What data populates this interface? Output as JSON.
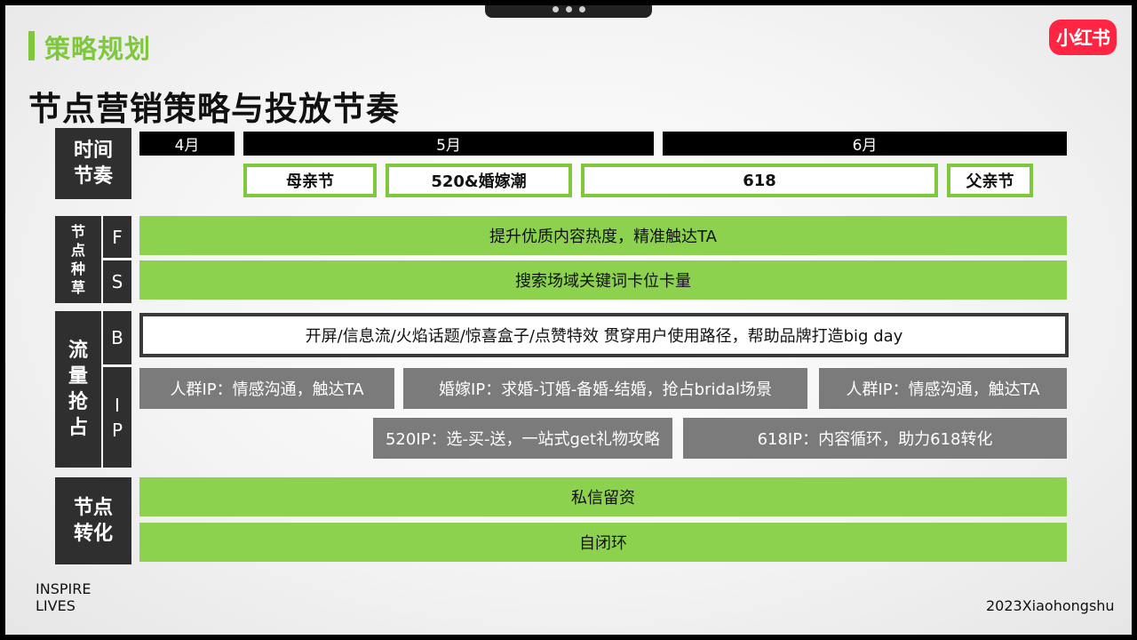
{
  "header": {
    "section": "策略规划",
    "title": "节点营销策略与投放节奏",
    "logo": "小红书"
  },
  "timeline": {
    "label": "时间节奏",
    "months": [
      "4月",
      "5月",
      "6月"
    ],
    "festivals": [
      "母亲节",
      "520&婚嫁潮",
      "618",
      "父亲节"
    ]
  },
  "seeding": {
    "label": "节点种草",
    "rows": [
      {
        "letter": "F",
        "text": "提升优质内容热度，精准触达TA"
      },
      {
        "letter": "S",
        "text": "搜索场域关键词卡位卡量"
      }
    ]
  },
  "traffic": {
    "label": "流量抢占",
    "b_letter": "B",
    "ip_letters": "I P",
    "b_text": "开屏/信息流/火焰话题/惊喜盒子/点赞特效  贯穿用户使用路径，帮助品牌打造big day",
    "ip_row1": [
      "人群IP：情感沟通，触达TA",
      "婚嫁IP：求婚-订婚-备婚-结婚，抢占bridal场景",
      "人群IP：情感沟通，触达TA"
    ],
    "ip_row2": [
      "520IP：选-买-送，一站式get礼物攻略",
      "618IP：内容循环，助力618转化"
    ]
  },
  "conversion": {
    "label": "节点转化",
    "rows": [
      "私信留资",
      "自闭环"
    ]
  },
  "footer": {
    "line1": "INSPIRE",
    "line2": "LIVES",
    "right": "2023Xiaohongshu"
  },
  "colors": {
    "accent_green": "#7fc73d",
    "bar_green": "#8cd24e",
    "dark": "#2f2f2f",
    "grey": "#7b7b7b",
    "brand_red": "#ff2442"
  }
}
